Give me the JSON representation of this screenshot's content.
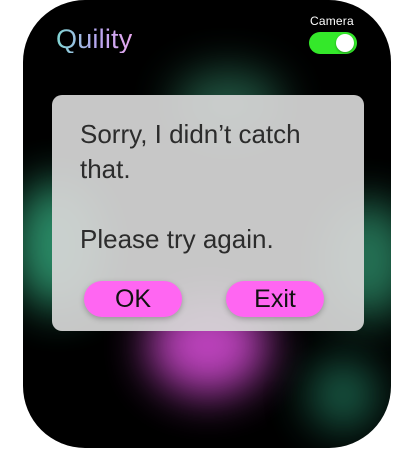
{
  "app": {
    "title": "Quility"
  },
  "camera": {
    "label": "Camera",
    "enabled": true
  },
  "dialog": {
    "message": "Sorry, I didn’t catch\nthat.\n\nPlease try again.",
    "ok_label": "OK",
    "exit_label": "Exit"
  },
  "colors": {
    "watch_background": "#000000",
    "dialog_background": "#d6d6d6",
    "button_background": "#ff66f2",
    "toggle_on": "#34e82a"
  }
}
